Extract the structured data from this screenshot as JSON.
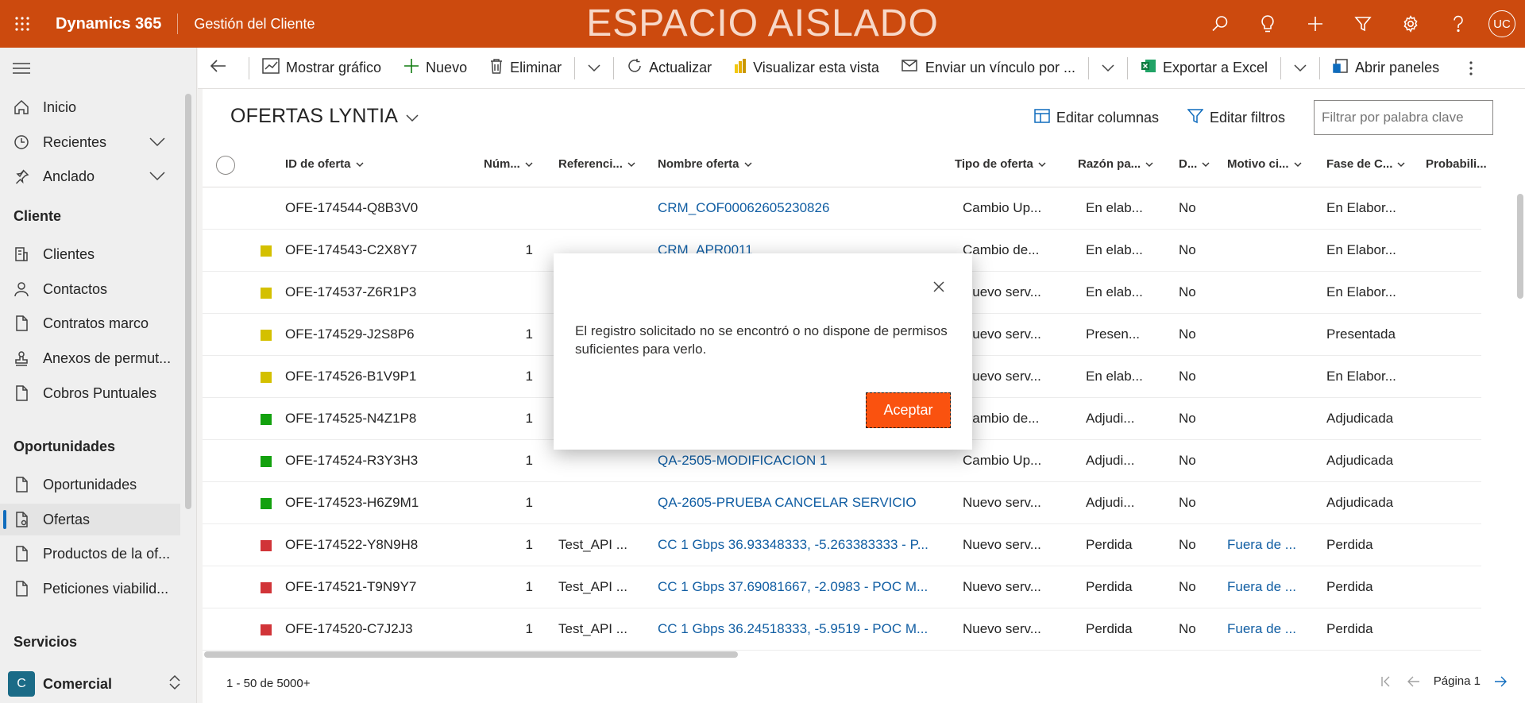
{
  "topbar": {
    "brand": "Dynamics 365",
    "app_name": "Gestión del Cliente",
    "environment_banner": "ESPACIO AISLADO",
    "user_initials": "UC",
    "icons": [
      "search-icon",
      "lightbulb-icon",
      "plus-icon",
      "filter-icon",
      "gear-icon",
      "help-icon"
    ],
    "color": "#cc4a0e"
  },
  "sidebar": {
    "top_items": [
      {
        "label": "Inicio",
        "icon": "home-icon"
      },
      {
        "label": "Recientes",
        "icon": "clock-icon"
      },
      {
        "label": "Anclado",
        "icon": "pin-icon"
      }
    ],
    "sections": [
      {
        "title": "Cliente",
        "items": [
          {
            "label": "Clientes",
            "icon": "building-icon"
          },
          {
            "label": "Contactos",
            "icon": "person-icon"
          },
          {
            "label": "Contratos marco",
            "icon": "document-icon"
          },
          {
            "label": "Anexos de permut...",
            "icon": "stamp-icon"
          },
          {
            "label": "Cobros Puntuales",
            "icon": "document-icon"
          }
        ]
      },
      {
        "title": "Oportunidades",
        "items": [
          {
            "label": "Oportunidades",
            "icon": "document-icon"
          },
          {
            "label": "Ofertas",
            "icon": "document-icon",
            "active": true
          },
          {
            "label": "Productos de la of...",
            "icon": "document-icon"
          },
          {
            "label": "Peticiones viabilid...",
            "icon": "document-icon"
          }
        ]
      },
      {
        "title": "Servicios",
        "items": []
      }
    ],
    "area": {
      "badge": "C",
      "label": "Comercial"
    }
  },
  "commandbar": {
    "back": "back-icon",
    "items": [
      {
        "label": "Mostrar gráfico",
        "icon": "chart-icon"
      },
      {
        "label": "Nuevo",
        "icon": "plus-icon"
      },
      {
        "label": "Eliminar",
        "icon": "trash-icon"
      },
      {
        "label": "Actualizar",
        "icon": "refresh-icon"
      },
      {
        "label": "Visualizar esta vista",
        "icon": "powerbi-icon"
      },
      {
        "label": "Enviar un vínculo por ...",
        "icon": "email-icon"
      },
      {
        "label": "Exportar a Excel",
        "icon": "excel-icon"
      },
      {
        "label": "Abrir paneles",
        "icon": "panel-icon"
      }
    ]
  },
  "view": {
    "title": "OFERTAS LYNTIA",
    "edit_columns": "Editar columnas",
    "edit_filters": "Editar filtros",
    "filter_placeholder": "Filtrar por palabra clave"
  },
  "grid": {
    "columns": [
      "ID de oferta",
      "Núm...",
      "Referenci...",
      "Nombre oferta",
      "Tipo de oferta",
      "Razón pa...",
      "D...",
      "Motivo ci...",
      "Fase de C...",
      "Probabili..."
    ],
    "rows": [
      {
        "status": "",
        "id": "OFE-174544-Q8B3V0",
        "num": "",
        "ref": "",
        "name": "CRM_COF00062605230826",
        "tipo": "Cambio Up...",
        "razon": "En elab...",
        "d": "No",
        "motivo": "",
        "fase": "En Elabor..."
      },
      {
        "status": "#d4c000",
        "id": "OFE-174543-C2X8Y7",
        "num": "1",
        "ref": "",
        "name": "CRM_APR0011",
        "tipo": "Cambio de...",
        "razon": "En elab...",
        "d": "No",
        "motivo": "",
        "fase": "En Elabor..."
      },
      {
        "status": "#d4c000",
        "id": "OFE-174537-Z6R1P3",
        "num": "",
        "ref": "",
        "name": "",
        "tipo": "Nuevo serv...",
        "razon": "En elab...",
        "d": "No",
        "motivo": "",
        "fase": "En Elabor..."
      },
      {
        "status": "#d4c000",
        "id": "OFE-174529-J2S8P6",
        "num": "1",
        "ref": "",
        "name": "",
        "tipo": "Nuevo serv...",
        "razon": "Presen...",
        "d": "No",
        "motivo": "",
        "fase": "Presentada"
      },
      {
        "status": "#d4c000",
        "id": "OFE-174526-B1V9P1",
        "num": "1",
        "ref": "",
        "name": "",
        "tipo": "Nuevo serv...",
        "razon": "En elab...",
        "d": "No",
        "motivo": "",
        "fase": "En Elabor..."
      },
      {
        "status": "#13a10e",
        "id": "OFE-174525-N4Z1P8",
        "num": "1",
        "ref": "",
        "name": "",
        "tipo": "Cambio de...",
        "razon": "Adjudi...",
        "d": "No",
        "motivo": "",
        "fase": "Adjudicada"
      },
      {
        "status": "#13a10e",
        "id": "OFE-174524-R3Y3H3",
        "num": "1",
        "ref": "",
        "name": "QA-2505-MODIFICACION 1",
        "tipo": "Cambio Up...",
        "razon": "Adjudi...",
        "d": "No",
        "motivo": "",
        "fase": "Adjudicada"
      },
      {
        "status": "#13a10e",
        "id": "OFE-174523-H6Z9M1",
        "num": "1",
        "ref": "",
        "name": "QA-2605-PRUEBA CANCELAR SERVICIO",
        "tipo": "Nuevo serv...",
        "razon": "Adjudi...",
        "d": "No",
        "motivo": "",
        "fase": "Adjudicada"
      },
      {
        "status": "#d13438",
        "id": "OFE-174522-Y8N9H8",
        "num": "1",
        "ref": "Test_API ...",
        "name": "CC 1 Gbps 36.93348333, -5.263383333 - P...",
        "tipo": "Nuevo serv...",
        "razon": "Perdida",
        "d": "No",
        "motivo": "Fuera de ...",
        "fase": "Perdida"
      },
      {
        "status": "#d13438",
        "id": "OFE-174521-T9N9Y7",
        "num": "1",
        "ref": "Test_API ...",
        "name": "CC 1 Gbps 37.69081667, -2.0983 - POC M...",
        "tipo": "Nuevo serv...",
        "razon": "Perdida",
        "d": "No",
        "motivo": "Fuera de ...",
        "fase": "Perdida"
      },
      {
        "status": "#d13438",
        "id": "OFE-174520-C7J2J3",
        "num": "1",
        "ref": "Test_API ...",
        "name": "CC 1 Gbps 36.24518333, -5.9519 - POC M...",
        "tipo": "Nuevo serv...",
        "razon": "Perdida",
        "d": "No",
        "motivo": "Fuera de ...",
        "fase": "Perdida"
      }
    ],
    "record_count": "1 - 50 de 5000+",
    "page_label": "Página 1"
  },
  "dialog": {
    "message": "El registro solicitado no se encontró o no dispone de permisos suficientes para verlo.",
    "ok_label": "Aceptar",
    "button_color": "#fa520f"
  }
}
